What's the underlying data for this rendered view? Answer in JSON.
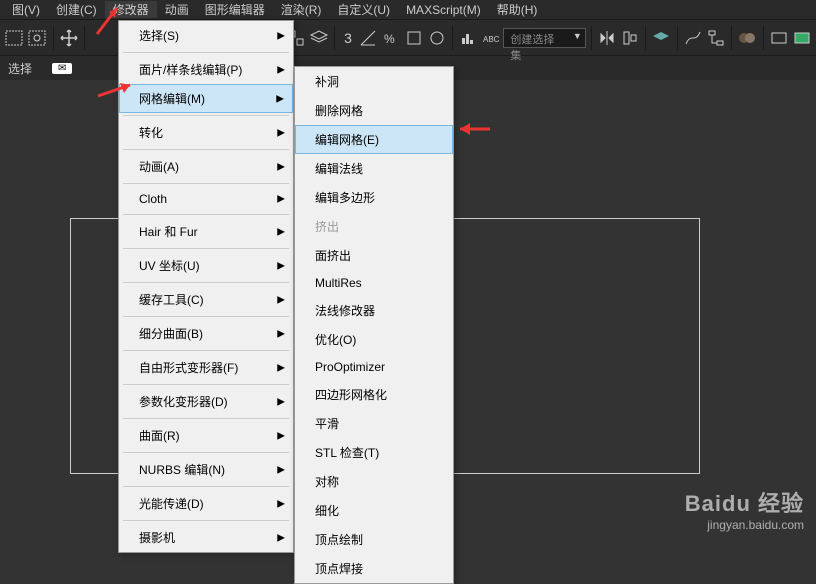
{
  "menubar": {
    "items": [
      "图(V)",
      "创建(C)",
      "修改器",
      "动画",
      "图形编辑器",
      "渲染(R)",
      "自定义(U)",
      "MAXScript(M)",
      "帮助(H)"
    ]
  },
  "toolbar": {
    "three": "3",
    "dropdown": "创建选择集"
  },
  "selbar": {
    "label": "选择"
  },
  "menu1": {
    "items": [
      {
        "label": "选择(S)",
        "arrow": true
      },
      {
        "sep": true
      },
      {
        "label": "面片/样条线编辑(P)",
        "arrow": true
      },
      {
        "label": "网格编辑(M)",
        "arrow": true,
        "highlight": true
      },
      {
        "sep": true
      },
      {
        "label": "转化",
        "arrow": true
      },
      {
        "sep": true
      },
      {
        "label": "动画(A)",
        "arrow": true
      },
      {
        "sep": true
      },
      {
        "label": "Cloth",
        "arrow": true
      },
      {
        "sep": true
      },
      {
        "label": "Hair 和 Fur",
        "arrow": true
      },
      {
        "sep": true
      },
      {
        "label": "UV 坐标(U)",
        "arrow": true
      },
      {
        "sep": true
      },
      {
        "label": "缓存工具(C)",
        "arrow": true
      },
      {
        "sep": true
      },
      {
        "label": "细分曲面(B)",
        "arrow": true
      },
      {
        "sep": true
      },
      {
        "label": "自由形式变形器(F)",
        "arrow": true
      },
      {
        "sep": true
      },
      {
        "label": "参数化变形器(D)",
        "arrow": true
      },
      {
        "sep": true
      },
      {
        "label": "曲面(R)",
        "arrow": true
      },
      {
        "sep": true
      },
      {
        "label": "NURBS 编辑(N)",
        "arrow": true
      },
      {
        "sep": true
      },
      {
        "label": "光能传递(D)",
        "arrow": true
      },
      {
        "sep": true
      },
      {
        "label": "摄影机",
        "arrow": true
      }
    ]
  },
  "menu2": {
    "items": [
      {
        "label": "补洞"
      },
      {
        "label": "删除网格"
      },
      {
        "label": "编辑网格(E)",
        "highlight": true
      },
      {
        "label": "编辑法线"
      },
      {
        "label": "编辑多边形"
      },
      {
        "label": "挤出",
        "disabled": true
      },
      {
        "label": "面挤出"
      },
      {
        "label": "MultiRes"
      },
      {
        "label": "法线修改器"
      },
      {
        "label": "优化(O)"
      },
      {
        "label": "ProOptimizer"
      },
      {
        "label": "四边形网格化"
      },
      {
        "label": "平滑"
      },
      {
        "label": "STL 检查(T)"
      },
      {
        "label": "对称"
      },
      {
        "label": "细化"
      },
      {
        "label": "顶点绘制"
      },
      {
        "label": "顶点焊接"
      }
    ]
  },
  "watermark": {
    "brand": "Baidu 经验",
    "url": "jingyan.baidu.com"
  }
}
